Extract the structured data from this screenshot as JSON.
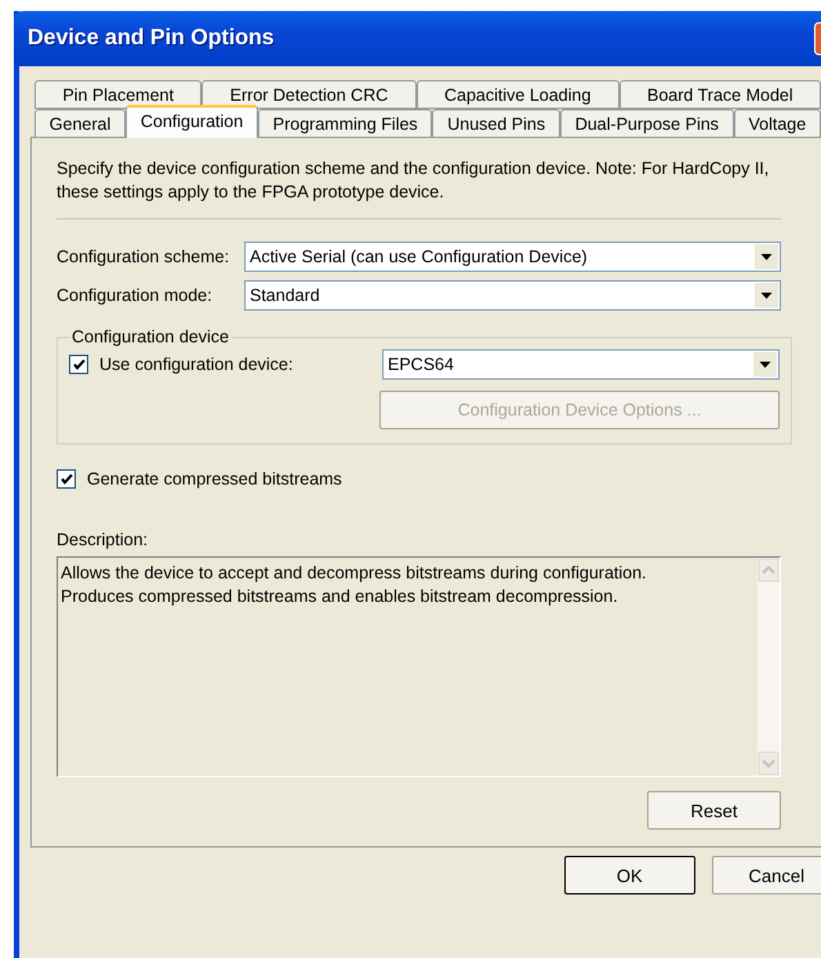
{
  "window": {
    "title": "Device and Pin Options"
  },
  "tab_rows": [
    [
      {
        "label": "Pin Placement",
        "selected": false
      },
      {
        "label": "Error Detection CRC",
        "selected": false
      },
      {
        "label": "Capacitive Loading",
        "selected": false
      },
      {
        "label": "Board Trace Model",
        "selected": false
      }
    ],
    [
      {
        "label": "General",
        "selected": false
      },
      {
        "label": "Configuration",
        "selected": true
      },
      {
        "label": "Programming Files",
        "selected": false
      },
      {
        "label": "Unused Pins",
        "selected": false
      },
      {
        "label": "Dual-Purpose Pins",
        "selected": false
      },
      {
        "label": "Voltage",
        "selected": false
      }
    ]
  ],
  "intro": "Specify the device configuration scheme and the configuration device. Note: For HardCopy II, these settings apply to the FPGA prototype device.",
  "fields": [
    {
      "label": "Configuration scheme:",
      "value": "Active Serial (can use Configuration Device)"
    },
    {
      "label": "Configuration mode:",
      "value": "Standard"
    }
  ],
  "configuration_device": {
    "title": "Configuration device",
    "checkbox": {
      "label": "Use configuration device:",
      "checked": true
    },
    "value": "EPCS64",
    "options_button": {
      "label": "Configuration Device Options ...",
      "disabled": true
    }
  },
  "compress_checkbox": {
    "label": "Generate compressed bitstreams",
    "checked": true
  },
  "description": {
    "label": "Description:",
    "lines": [
      "Allows the device to accept and decompress bitstreams during configuration.",
      "Produces compressed bitstreams and enables bitstream decompression."
    ]
  },
  "reset_button": "Reset",
  "buttons": [
    "OK",
    "Cancel"
  ]
}
